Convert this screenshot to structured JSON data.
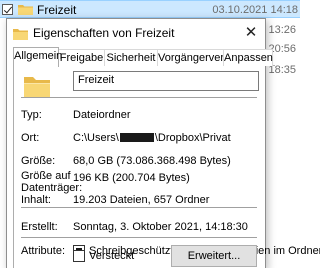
{
  "explorer": {
    "selected_row": {
      "name": "Freizeit",
      "date": "03.10.2021 14:18"
    },
    "other_dates": [
      "11.2022 13:26",
      "12.2021 20:56",
      "11.2021 18:35"
    ]
  },
  "dialog": {
    "title": "Eigenschaften von Freizeit",
    "close_glyph": "✕",
    "tabs": [
      "Allgemein",
      "Freigabe",
      "Sicherheit",
      "Vorgängerversionen",
      "Anpassen"
    ],
    "active_tab": "Allgemein",
    "name_value": "Freizeit",
    "fields": {
      "type_label": "Typ:",
      "type_value": "Dateiordner",
      "location_label": "Ort:",
      "location_prefix": "C:\\Users\\",
      "location_suffix": "\\Dropbox\\Privat",
      "size_label": "Größe:",
      "size_value": "68,0 GB (73.086.368.498 Bytes)",
      "ondisk_label": "Größe auf Datenträger:",
      "ondisk_value": "196 KB (200.704 Bytes)",
      "contents_label": "Inhalt:",
      "contents_value": "19.203 Dateien, 657 Ordner",
      "created_label": "Erstellt:",
      "created_value": "Sonntag, 3. Oktober 2021, 14:18:30",
      "attributes_label": "Attribute:"
    },
    "attributes": {
      "readonly_label": "Schreibgeschützt (betrifft nur Dateien im Ordner)",
      "readonly_state": "indeterminate",
      "hidden_label": "Versteckt",
      "hidden_checked": false,
      "advanced_button": "Erweitert..."
    }
  },
  "colors": {
    "selection": "#cce8ff",
    "folder": "#f8d775",
    "folder_dark": "#e8b94a"
  }
}
